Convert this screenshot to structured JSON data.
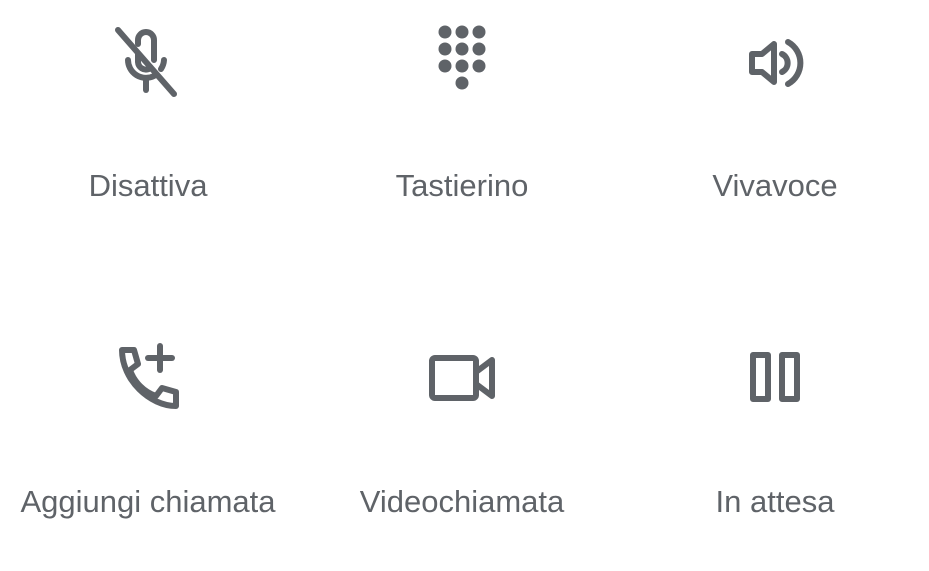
{
  "call_controls": {
    "row1": [
      {
        "id": "mute",
        "label": "Disattiva",
        "icon": "mic-off-icon"
      },
      {
        "id": "keypad",
        "label": "Tastierino",
        "icon": "dialpad-icon"
      },
      {
        "id": "speaker",
        "label": "Vivavoce",
        "icon": "speaker-icon"
      }
    ],
    "row2": [
      {
        "id": "add-call",
        "label": "Aggiungi chiamata",
        "icon": "add-call-icon"
      },
      {
        "id": "video",
        "label": "Videochiamata",
        "icon": "videocam-icon"
      },
      {
        "id": "hold",
        "label": "In attesa",
        "icon": "pause-icon"
      }
    ]
  },
  "colors": {
    "icon": "#5f6368",
    "text": "#5f6368",
    "background": "#ffffff"
  }
}
